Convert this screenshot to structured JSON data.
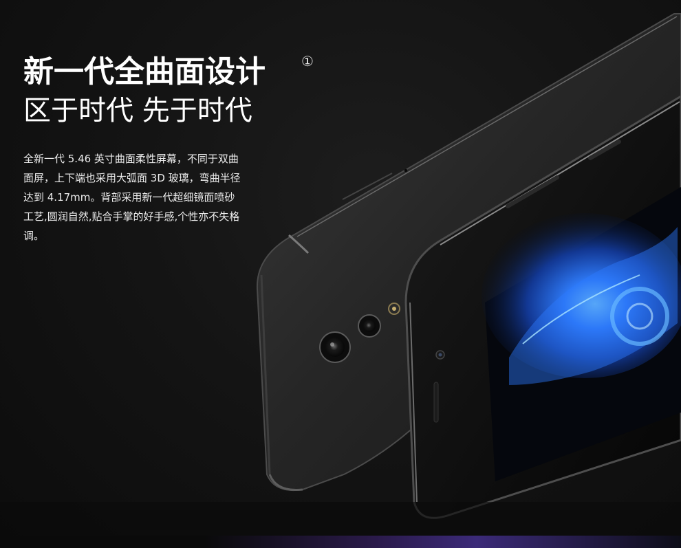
{
  "hero": {
    "headline": "新一代全曲面设计",
    "footnote_mark": "①",
    "subheadline": "区于时代 先于时代",
    "description": "全新一代 5.46 英寸曲面柔性屏幕，不同于双曲面屏，上下端也采用大弧面 3D 玻璃，弯曲半径达到  4.17mm。背部采用新一代超细镜面喷砂工艺,圆润自然,贴合手掌的好手感,个性亦不失格调。"
  },
  "colors": {
    "background": "#121212",
    "text": "#ffffff",
    "screen_accent": "#1f6fff"
  }
}
